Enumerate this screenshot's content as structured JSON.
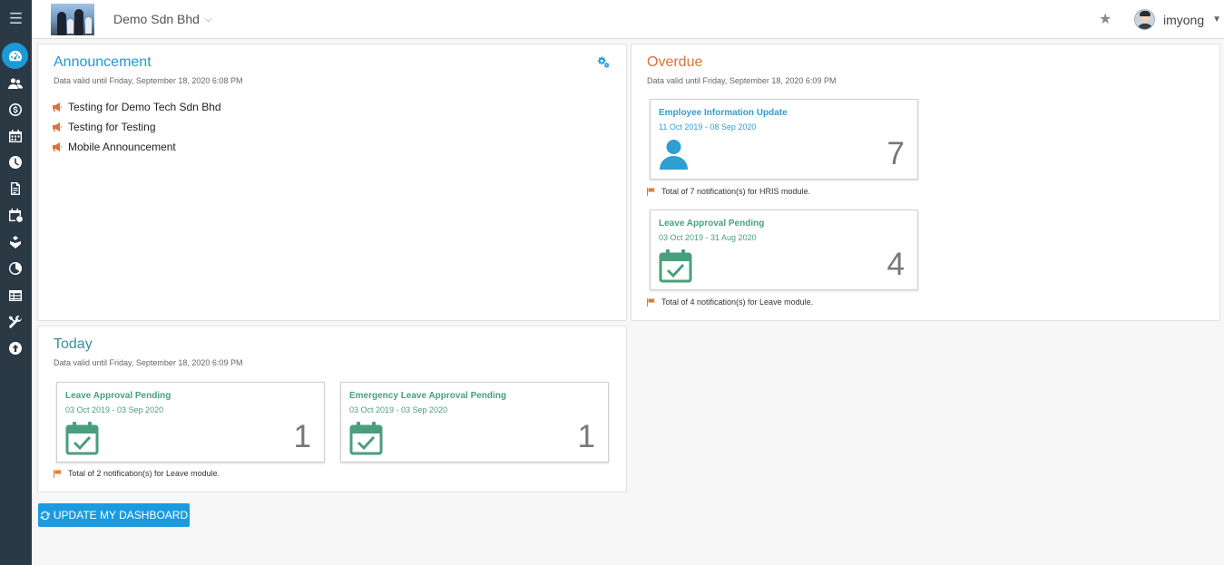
{
  "topbar": {
    "company": "Demo Sdn Bhd",
    "username": "imyong"
  },
  "sidebar": {
    "items": [
      {
        "icon": "dashboard-icon"
      },
      {
        "icon": "users-icon"
      },
      {
        "icon": "payroll-icon"
      },
      {
        "icon": "calendar-grid-icon"
      },
      {
        "icon": "clock-icon"
      },
      {
        "icon": "document-icon"
      },
      {
        "icon": "leave-calendar-icon"
      },
      {
        "icon": "claims-icon"
      },
      {
        "icon": "reports-icon"
      },
      {
        "icon": "table-icon"
      },
      {
        "icon": "tools-icon"
      },
      {
        "icon": "upload-icon"
      }
    ]
  },
  "announcement": {
    "title": "Announcement",
    "valid": "Data valid until Friday, September 18, 2020 6:08 PM",
    "items": [
      "Testing for Demo Tech Sdn Bhd",
      "Testing for Testing",
      "Mobile Announcement"
    ]
  },
  "overdue": {
    "title": "Overdue",
    "valid": "Data valid until Friday, September 18, 2020 6:09 PM",
    "cards": [
      {
        "title": "Employee Information Update",
        "dates": "11 Oct 2019 - 08 Sep 2020",
        "count": "7",
        "note": "Total of 7 notification(s) for HRIS module."
      },
      {
        "title": "Leave Approval Pending",
        "dates": "03 Oct 2019 - 31 Aug 2020",
        "count": "4",
        "note": "Total of 4 notification(s) for Leave module."
      }
    ]
  },
  "today": {
    "title": "Today",
    "valid": "Data valid until Friday, September 18, 2020 6:09 PM",
    "cards": [
      {
        "title": "Leave Approval Pending",
        "dates": "03 Oct 2019 - 03 Sep 2020",
        "count": "1"
      },
      {
        "title": "Emergency Leave Approval Pending",
        "dates": "03 Oct 2019 - 03 Sep 2020",
        "count": "1"
      }
    ],
    "note": "Total of 2 notification(s) for Leave module."
  },
  "update_button": "UPDATE MY DASHBOARD",
  "colors": {
    "sidebar_bg": "#2b3945",
    "accent_blue": "#1a9bd7",
    "overdue_orange": "#d9733a",
    "today_teal": "#3b8d9d",
    "leave_green": "#4a9e7e"
  }
}
